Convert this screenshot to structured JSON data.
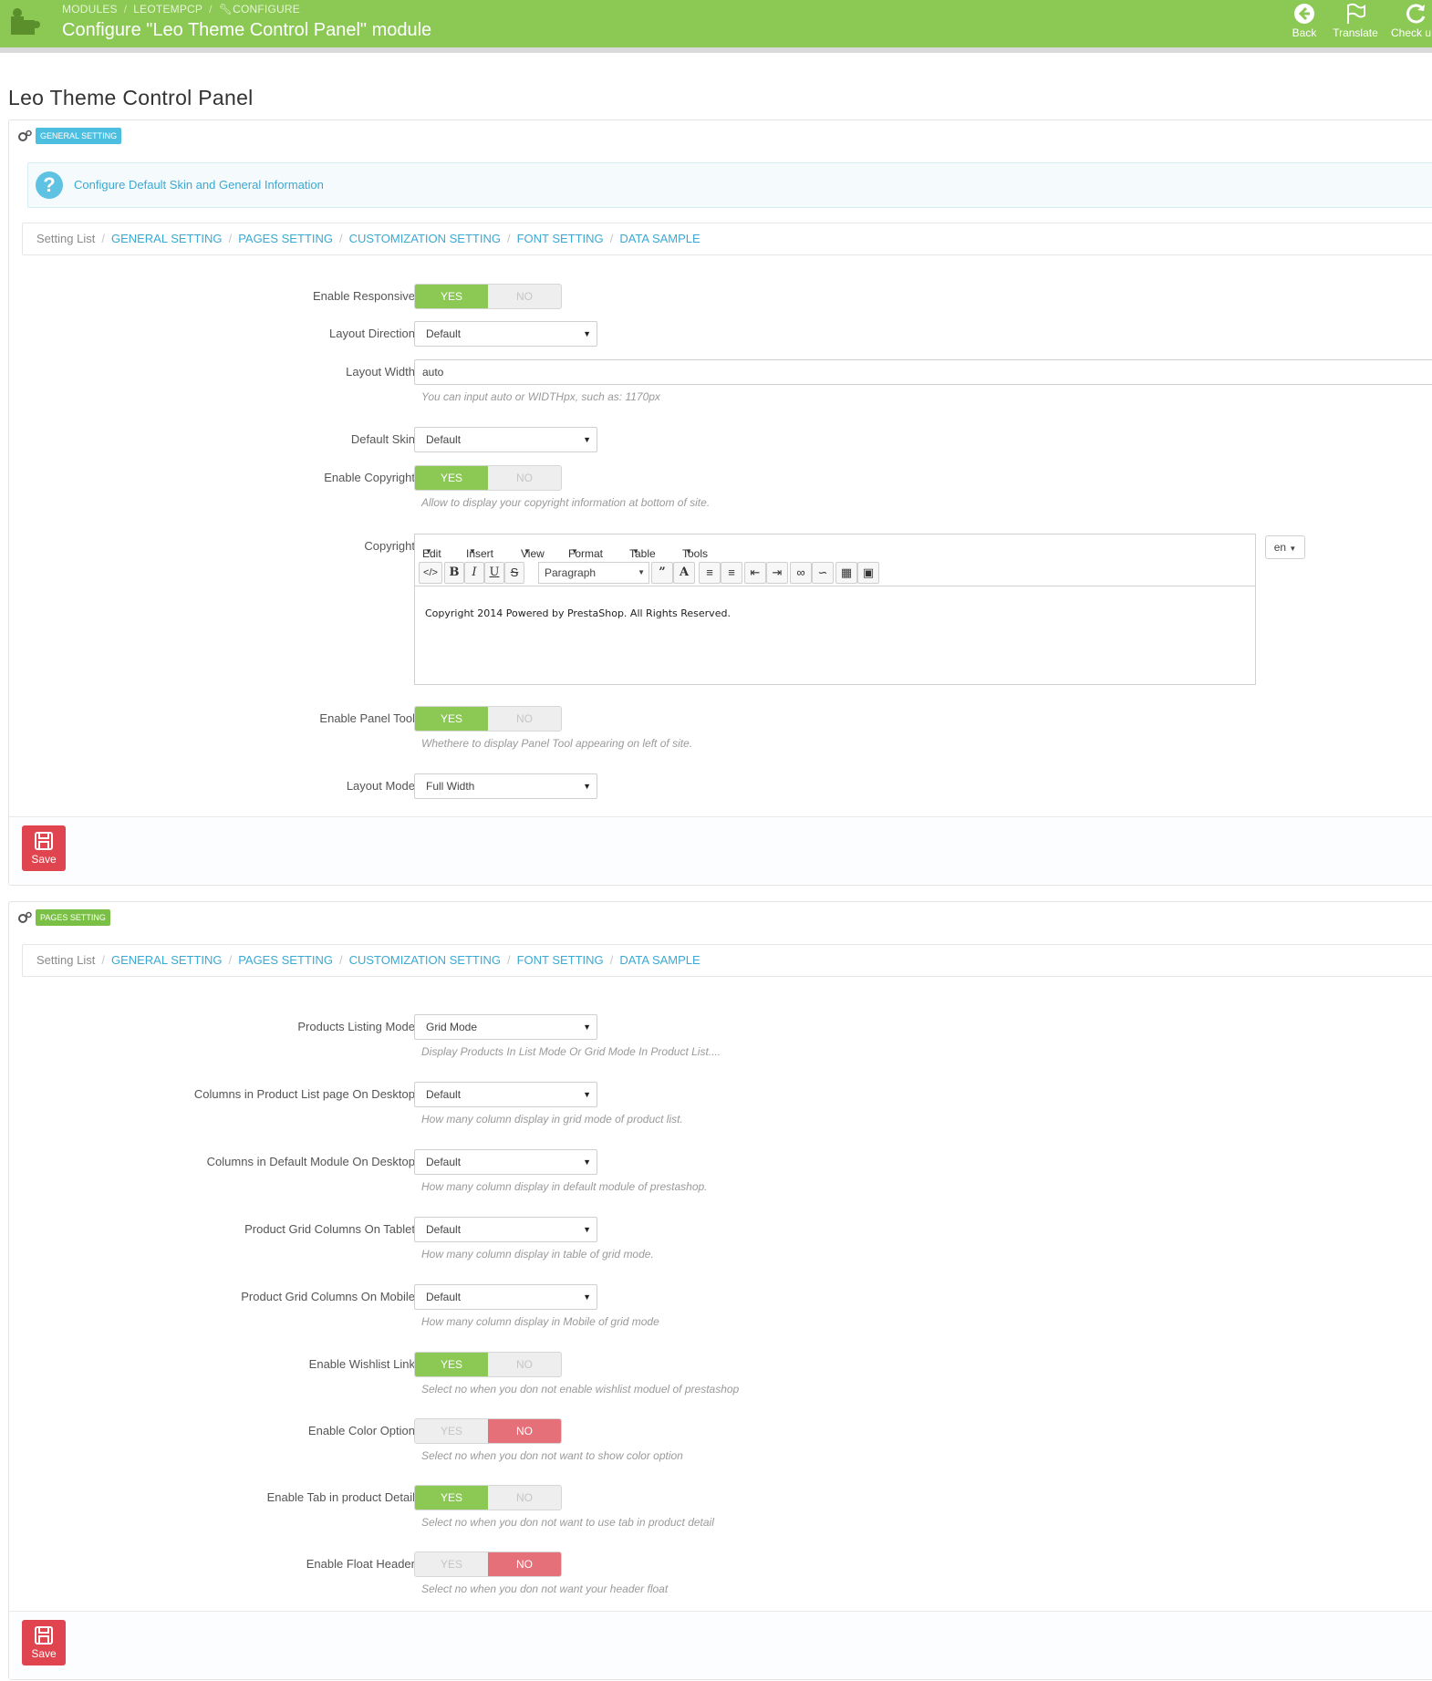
{
  "header": {
    "breadcrumb": [
      "MODULES",
      "LEOTEMPCP",
      "CONFIGURE"
    ],
    "title": "Configure \"Leo Theme Control Panel\" module",
    "buttons": [
      {
        "label": "Back",
        "icon": "back-arrow-icon"
      },
      {
        "label": "Translate",
        "icon": "flag-icon"
      },
      {
        "label": "Check u",
        "icon": "refresh-icon"
      }
    ],
    "color": "#8bc954"
  },
  "page_title": "Leo Theme Control Panel",
  "general_panel": {
    "badge": "GENERAL SETTING",
    "info": "Configure Default Skin and General Information",
    "breadcrumb": {
      "first": "Setting List",
      "links": [
        "GENERAL SETTING",
        "PAGES SETTING",
        "CUSTOMIZATION SETTING",
        "FONT SETTING",
        "DATA SAMPLE"
      ]
    },
    "fields": {
      "enable_responsive": {
        "label": "Enable Responsive",
        "yes": "YES",
        "no": "NO",
        "value": true
      },
      "layout_direction": {
        "label": "Layout Direction",
        "value": "Default"
      },
      "layout_width": {
        "label": "Layout Width",
        "value": "auto",
        "help": "You can input auto or WIDTHpx, such as: 1170px"
      },
      "default_skin": {
        "label": "Default Skin",
        "value": "Default"
      },
      "enable_copyright": {
        "label": "Enable Copyright",
        "yes": "YES",
        "no": "NO",
        "value": true,
        "help": "Allow to display your copyright information at bottom of site."
      },
      "copyright": {
        "label": "Copyright",
        "menu": [
          "Edit",
          "Insert",
          "View",
          "Format",
          "Table",
          "Tools"
        ],
        "paragraph": "Paragraph",
        "content": "Copyright 2014 Powered by PrestaShop. All Rights Reserved.",
        "lang": "en"
      },
      "enable_panel_tool": {
        "label": "Enable Panel Tool",
        "yes": "YES",
        "no": "NO",
        "value": true,
        "help": "Whethere to display Panel Tool appearing on left of site."
      },
      "layout_mode": {
        "label": "Layout Mode",
        "value": "Full Width"
      }
    },
    "save_label": "Save"
  },
  "pages_panel": {
    "badge": "PAGES SETTING",
    "breadcrumb": {
      "first": "Setting List",
      "links": [
        "GENERAL SETTING",
        "PAGES SETTING",
        "CUSTOMIZATION SETTING",
        "FONT SETTING",
        "DATA SAMPLE"
      ]
    },
    "fields": {
      "products_listing_mode": {
        "label": "Products Listing Mode",
        "value": "Grid Mode",
        "help": "Display Products In List Mode Or Grid Mode In Product List...."
      },
      "columns_product_list_desktop": {
        "label": "Columns in Product List page On Desktop",
        "value": "Default",
        "help": "How many column display in grid mode of product list."
      },
      "columns_default_module_desktop": {
        "label": "Columns in Default Module On Desktop",
        "value": "Default",
        "help": "How many column display in default module of prestashop."
      },
      "grid_columns_tablet": {
        "label": "Product Grid Columns On Tablet",
        "value": "Default",
        "help": "How many column display in table of grid mode."
      },
      "grid_columns_mobile": {
        "label": "Product Grid Columns On Mobile",
        "value": "Default",
        "help": "How many column display in Mobile of grid mode"
      },
      "enable_wishlist_link": {
        "label": "Enable Wishlist Link",
        "yes": "YES",
        "no": "NO",
        "value": true,
        "help": "Select no when you don not enable wishlist moduel of prestashop"
      },
      "enable_color_option": {
        "label": "Enable Color Option",
        "yes": "YES",
        "no": "NO",
        "value": false,
        "help": "Select no when you don not want to show color option"
      },
      "enable_tab_product_detail": {
        "label": "Enable Tab in product Detail",
        "yes": "YES",
        "no": "NO",
        "value": true,
        "help": "Select no when you don not want to use tab in product detail"
      },
      "enable_float_header": {
        "label": "Enable Float Header",
        "yes": "YES",
        "no": "NO",
        "value": false,
        "help": "Select no when you don not want your header float"
      }
    },
    "save_label": "Save"
  },
  "colors": {
    "accent_green": "#8bc954",
    "danger_red": "#e0454f",
    "info_blue": "#3aa9d3"
  }
}
